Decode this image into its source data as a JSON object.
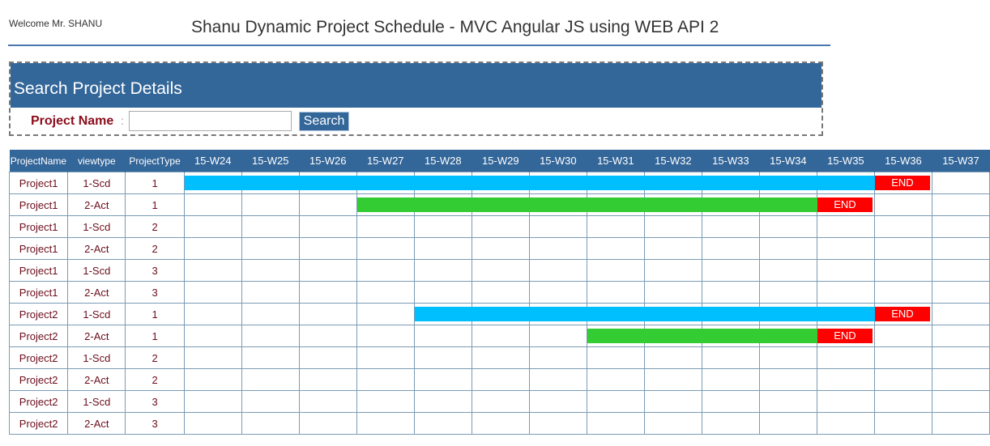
{
  "header": {
    "welcome": "Welcome Mr. SHANU",
    "title": "Shanu Dynamic Project Schedule - MVC Angular JS using WEB API 2"
  },
  "search": {
    "heading": "Search Project Details",
    "label": "Project Name",
    "colon": ":",
    "input_value": "",
    "input_placeholder": "",
    "button_label": "Search"
  },
  "colors": {
    "header_bg": "#336699",
    "scheduled": "#00bfff",
    "actual": "#33cc33",
    "end": "#ff0000"
  },
  "grid": {
    "columns": [
      "ProjectName",
      "viewtype",
      "ProjectType"
    ],
    "weeks": [
      "15-W24",
      "15-W25",
      "15-W26",
      "15-W27",
      "15-W28",
      "15-W29",
      "15-W30",
      "15-W31",
      "15-W32",
      "15-W33",
      "15-W34",
      "15-W35",
      "15-W36",
      "15-W37"
    ],
    "end_label": "END",
    "rows": [
      {
        "project": "Project1",
        "viewtype": "1-Scd",
        "type": "1",
        "bar": {
          "kind": "scheduled",
          "start": "15-W24",
          "end": "15-W35",
          "end_marker": "15-W36"
        }
      },
      {
        "project": "Project1",
        "viewtype": "2-Act",
        "type": "1",
        "bar": {
          "kind": "actual",
          "start": "15-W27",
          "end": "15-W34",
          "end_marker": "15-W35"
        }
      },
      {
        "project": "Project1",
        "viewtype": "1-Scd",
        "type": "2",
        "bar": null
      },
      {
        "project": "Project1",
        "viewtype": "2-Act",
        "type": "2",
        "bar": null
      },
      {
        "project": "Project1",
        "viewtype": "1-Scd",
        "type": "3",
        "bar": null
      },
      {
        "project": "Project1",
        "viewtype": "2-Act",
        "type": "3",
        "bar": null
      },
      {
        "project": "Project2",
        "viewtype": "1-Scd",
        "type": "1",
        "bar": {
          "kind": "scheduled",
          "start": "15-W28",
          "end": "15-W35",
          "end_marker": "15-W36"
        }
      },
      {
        "project": "Project2",
        "viewtype": "2-Act",
        "type": "1",
        "bar": {
          "kind": "actual",
          "start": "15-W31",
          "end": "15-W34",
          "end_marker": "15-W35"
        }
      },
      {
        "project": "Project2",
        "viewtype": "1-Scd",
        "type": "2",
        "bar": null
      },
      {
        "project": "Project2",
        "viewtype": "2-Act",
        "type": "2",
        "bar": null
      },
      {
        "project": "Project2",
        "viewtype": "1-Scd",
        "type": "3",
        "bar": null
      },
      {
        "project": "Project2",
        "viewtype": "2-Act",
        "type": "3",
        "bar": null
      }
    ]
  }
}
